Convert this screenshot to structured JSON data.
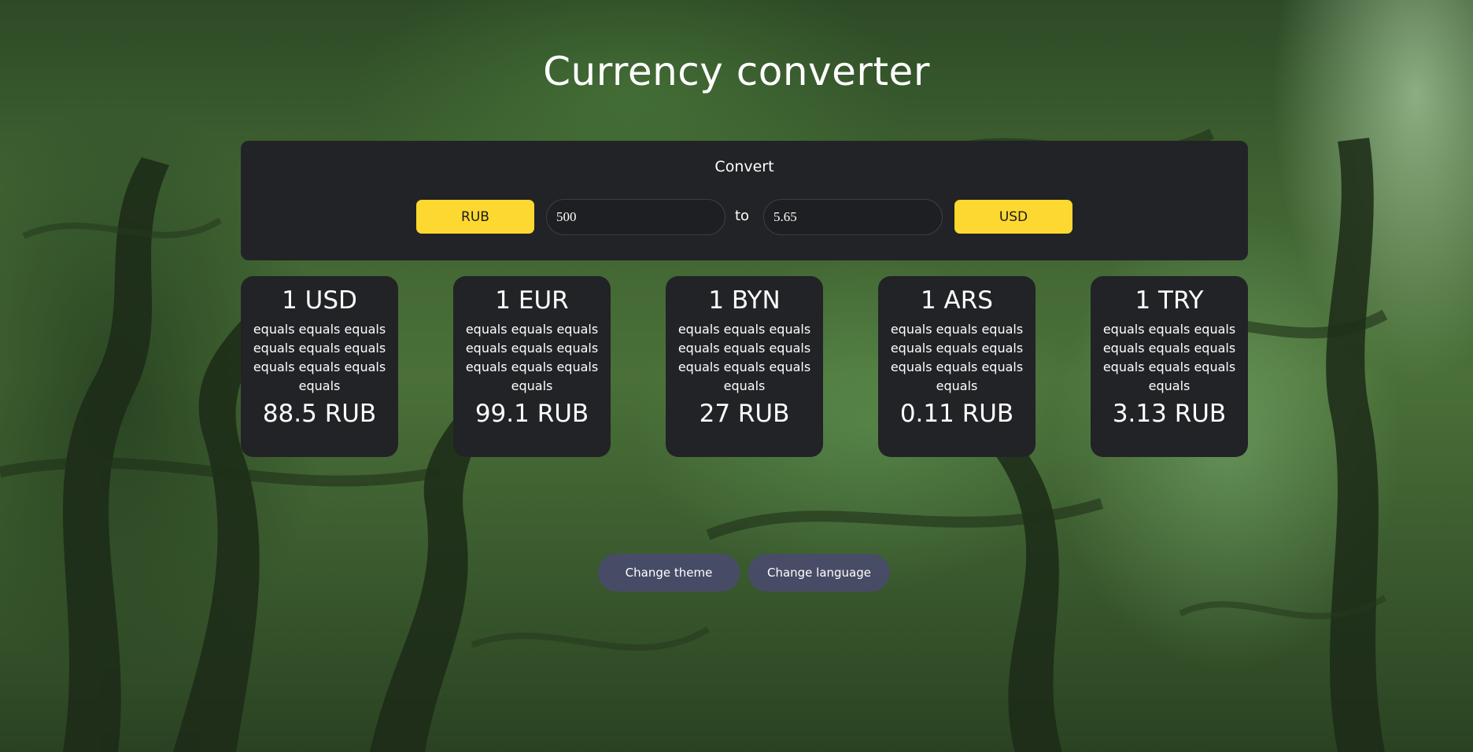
{
  "page": {
    "title": "Currency converter"
  },
  "converter": {
    "label": "Convert",
    "from_currency": "RUB",
    "from_amount": "500",
    "to_label": "to",
    "to_amount": "5.65",
    "to_currency": "USD"
  },
  "rates": [
    {
      "head": "1 USD",
      "mid": "equals equals equals equals equals equals equals equals equals equals",
      "value": "88.5 RUB"
    },
    {
      "head": "1 EUR",
      "mid": "equals equals equals equals equals equals equals equals equals equals",
      "value": "99.1 RUB"
    },
    {
      "head": "1 BYN",
      "mid": "equals equals equals equals equals equals equals equals equals equals",
      "value": "27 RUB"
    },
    {
      "head": "1 ARS",
      "mid": "equals equals equals equals equals equals equals equals equals equals",
      "value": "0.11 RUB"
    },
    {
      "head": "1 TRY",
      "mid": "equals equals equals equals equals equals equals equals equals equals",
      "value": "3.13 RUB"
    }
  ],
  "footer": {
    "theme_button": "Change theme",
    "language_button": "Change language"
  },
  "colors": {
    "accent": "#fdd830",
    "panel": "#222326",
    "pill": "#4b4876"
  }
}
